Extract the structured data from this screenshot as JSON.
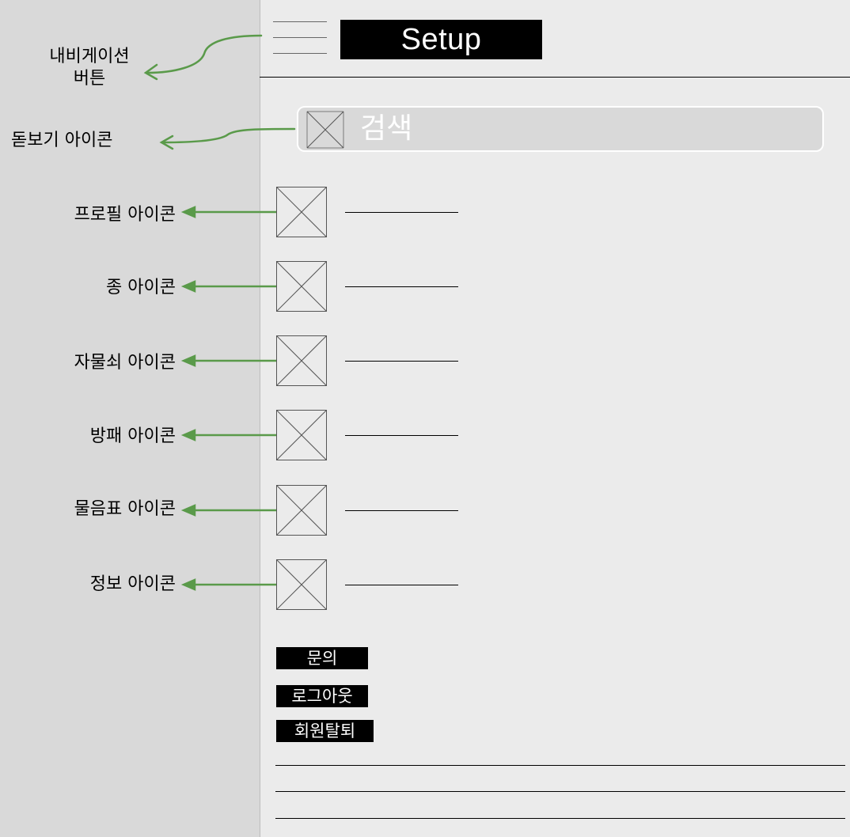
{
  "header": {
    "title": "Setup"
  },
  "search": {
    "placeholder": "검색"
  },
  "annotations": {
    "nav_button": [
      "내비게이션",
      "버튼"
    ],
    "magnifier_icon": "돋보기 아이콘",
    "profile_icon": "프로필 아이콘",
    "bell_icon": "종 아이콘",
    "lock_icon": "자물쇠 아이콘",
    "shield_icon": "방패 아이콘",
    "question_icon": "물음표 아이콘",
    "info_icon": "정보 아이콘"
  },
  "menu": {
    "items": [
      {
        "icon": "profile-icon"
      },
      {
        "icon": "bell-icon"
      },
      {
        "icon": "lock-icon"
      },
      {
        "icon": "shield-icon"
      },
      {
        "icon": "question-icon"
      },
      {
        "icon": "info-icon"
      }
    ]
  },
  "actions": {
    "contact": "문의",
    "logout": "로그아웃",
    "withdraw": "회원탈퇴"
  },
  "colors": {
    "arrow": "#5a9a4a",
    "left_panel": "#d9d9d9",
    "screen": "#ebebeb",
    "button_bg": "#000000",
    "button_text": "#ffffff"
  }
}
